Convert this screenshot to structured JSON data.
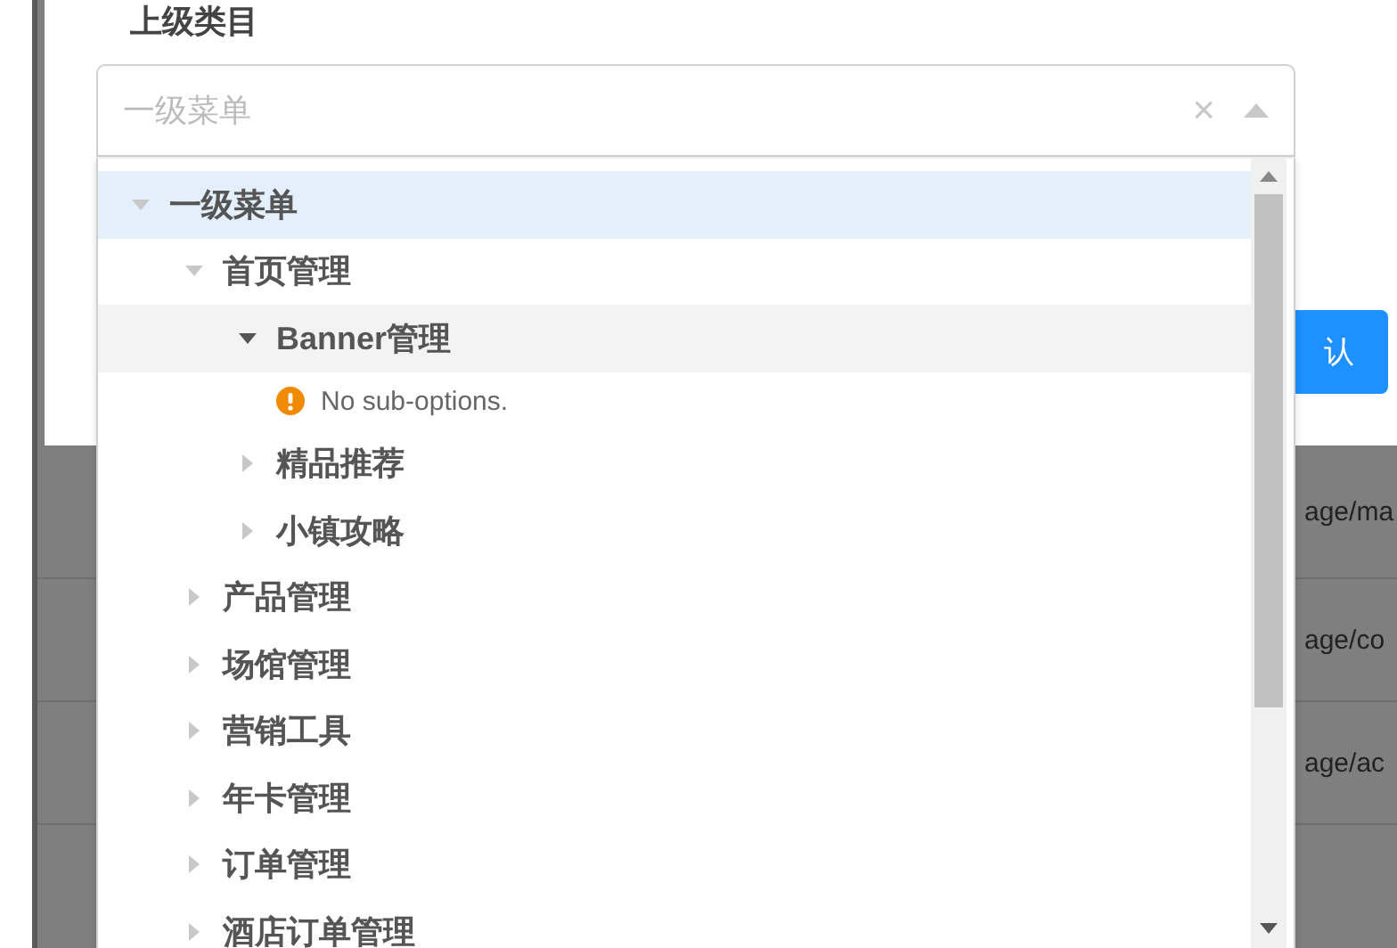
{
  "dialog": {
    "field_label": "上级类目",
    "confirm_button": "认"
  },
  "background_table": {
    "rows": [
      {
        "cell": "age/ma"
      },
      {
        "cell": "age/co"
      },
      {
        "cell": "age/ac"
      }
    ]
  },
  "select": {
    "placeholder": "一级菜单",
    "clear": "×",
    "expanded": true,
    "tree": [
      {
        "kind": "node",
        "label": "一级菜单",
        "expanded": true,
        "selected": true,
        "hovered": false,
        "children": [
          {
            "kind": "node",
            "label": "首页管理",
            "expanded": true,
            "selected": false,
            "hovered": false,
            "children": [
              {
                "kind": "node",
                "label": "Banner管理",
                "expanded": true,
                "selected": false,
                "hovered": true,
                "children": [
                  {
                    "kind": "message",
                    "label": "No sub-options."
                  }
                ]
              },
              {
                "kind": "node",
                "label": "精品推荐",
                "expanded": false,
                "selected": false,
                "hovered": false
              },
              {
                "kind": "node",
                "label": "小镇攻略",
                "expanded": false,
                "selected": false,
                "hovered": false
              }
            ]
          },
          {
            "kind": "node",
            "label": "产品管理",
            "expanded": false,
            "selected": false,
            "hovered": false
          },
          {
            "kind": "node",
            "label": "场馆管理",
            "expanded": false,
            "selected": false,
            "hovered": false
          },
          {
            "kind": "node",
            "label": "营销工具",
            "expanded": false,
            "selected": false,
            "hovered": false
          },
          {
            "kind": "node",
            "label": "年卡管理",
            "expanded": false,
            "selected": false,
            "hovered": false
          },
          {
            "kind": "node",
            "label": "订单管理",
            "expanded": false,
            "selected": false,
            "hovered": false
          },
          {
            "kind": "node",
            "label": "酒店订单管理",
            "expanded": false,
            "selected": false,
            "hovered": false
          }
        ]
      }
    ]
  }
}
